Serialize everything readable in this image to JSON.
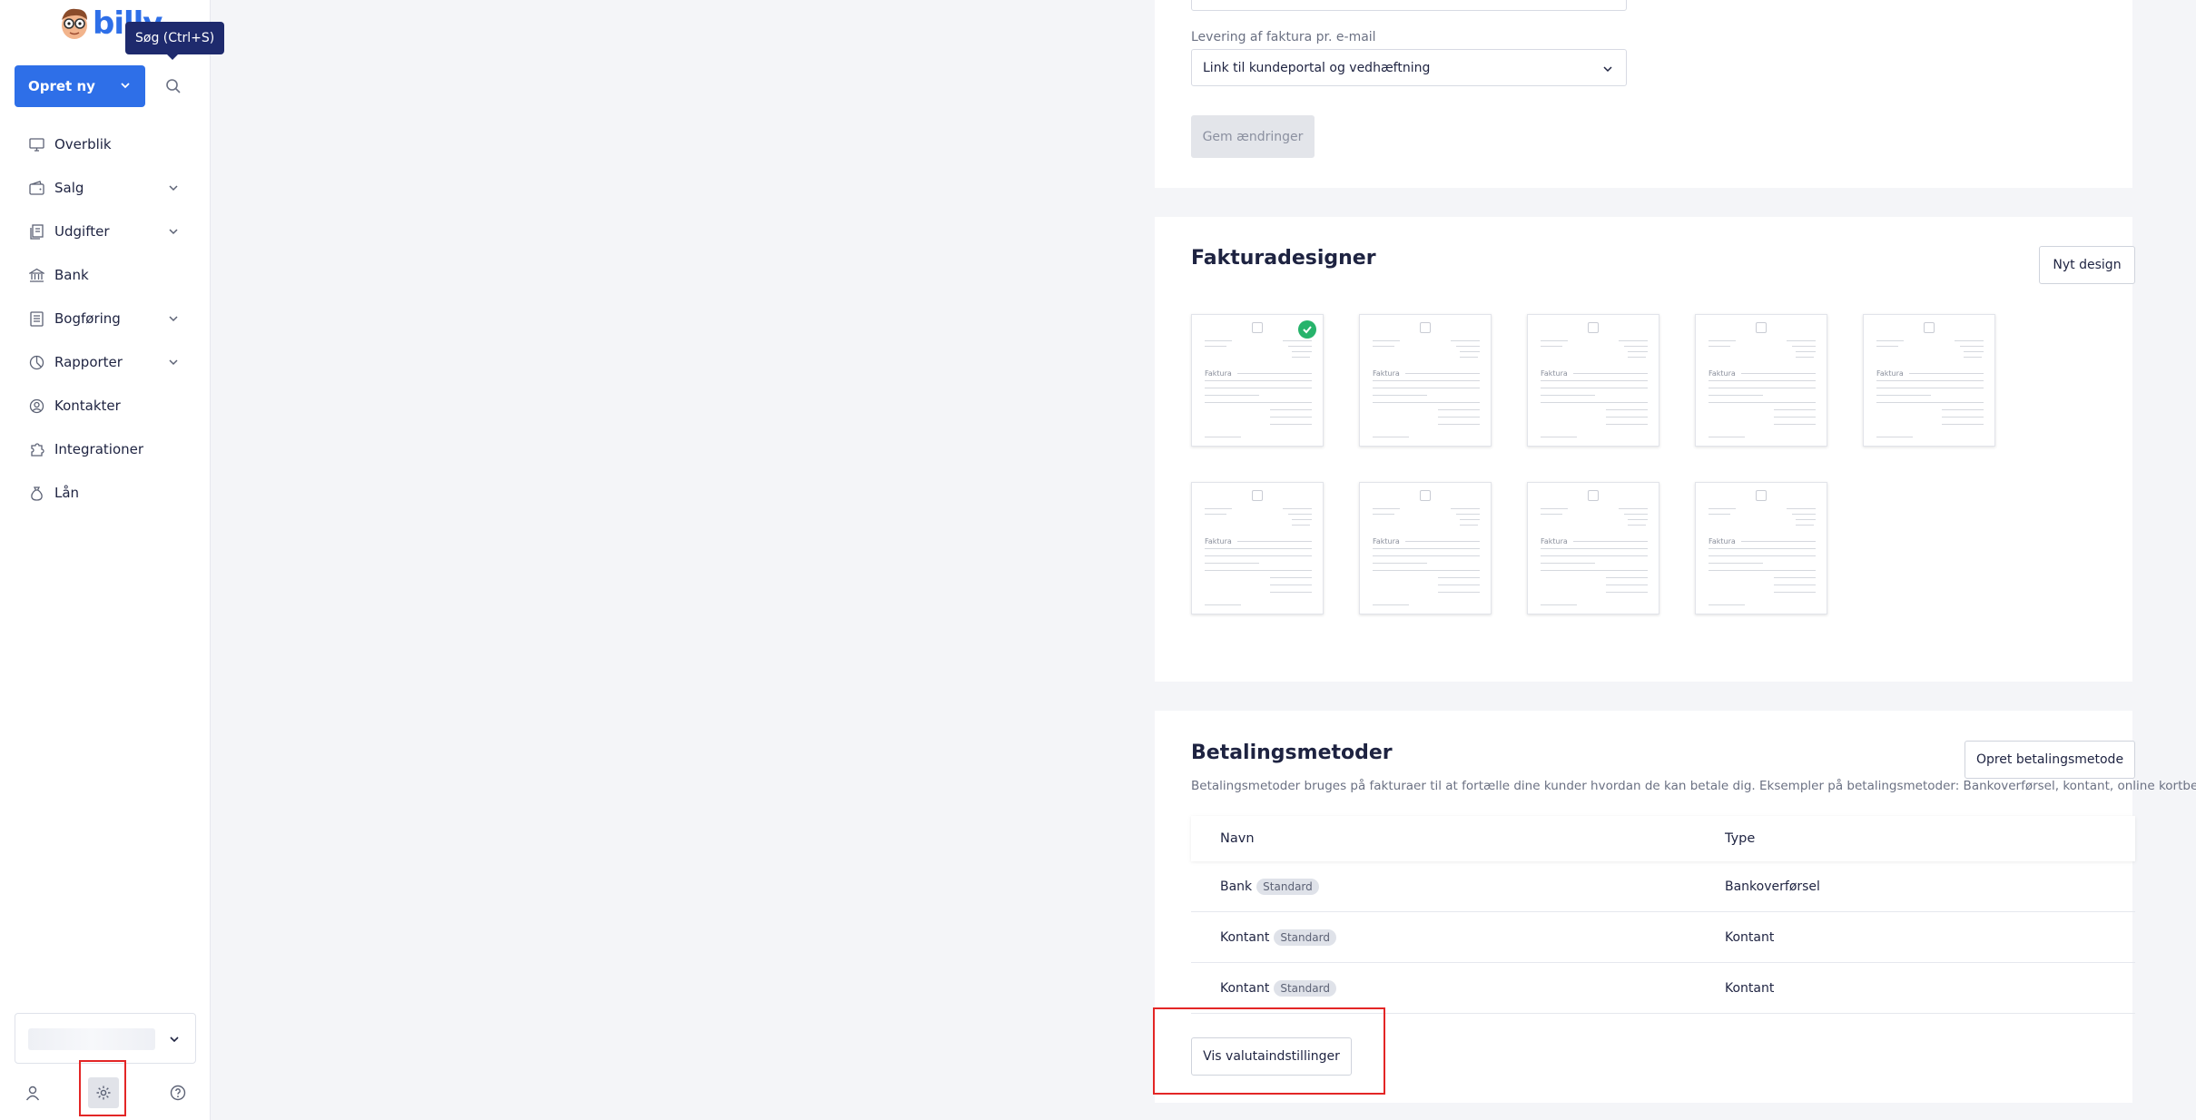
{
  "brand": {
    "logo_text": "billy"
  },
  "sidebar": {
    "create_label": "Opret ny",
    "search_tooltip": "Søg (Ctrl+S)",
    "items": [
      {
        "label": "Overblik",
        "icon": "monitor-icon"
      },
      {
        "label": "Salg",
        "icon": "wallet-icon"
      },
      {
        "label": "Udgifter",
        "icon": "receipts-icon"
      },
      {
        "label": "Bank",
        "icon": "bank-icon"
      },
      {
        "label": "Bogføring",
        "icon": "ledger-icon"
      },
      {
        "label": "Rapporter",
        "icon": "chart-icon"
      },
      {
        "label": "Kontakter",
        "icon": "contact-icon"
      },
      {
        "label": "Integrationer",
        "icon": "puzzle-icon"
      },
      {
        "label": "Lån",
        "icon": "money-bag-icon"
      }
    ]
  },
  "invoice_settings": {
    "delivery_label": "Levering af faktura pr. e-mail",
    "delivery_value": "Link til kundeportal og vedhæftning",
    "save_label": "Gem ændringer"
  },
  "designer": {
    "title": "Fakturadesigner",
    "new_design_label": "Nyt design",
    "thumbnail_text": "Faktura"
  },
  "payment_methods": {
    "title": "Betalingsmetoder",
    "create_label": "Opret betalingsmetode",
    "description": "Betalingsmetoder bruges på fakturaer til at fortælle dine kunder hvordan de kan betale dig. Eksempler på betalingsmetoder: Bankoverførsel, kontant, online kortbetaling.",
    "columns": [
      "Navn",
      "Type"
    ],
    "rows": [
      {
        "name": "Bank",
        "badge": "Standard",
        "type": "Bankoverførsel"
      },
      {
        "name": "Kontant",
        "badge": "Standard",
        "type": "Kontant"
      },
      {
        "name": "Kontant",
        "badge": "Standard",
        "type": "Kontant"
      }
    ],
    "currency_settings_label": "Vis valutaindstillinger"
  },
  "colors": {
    "primary": "#2e6fe8",
    "highlight_box": "#e32626",
    "check": "#27b36b"
  }
}
